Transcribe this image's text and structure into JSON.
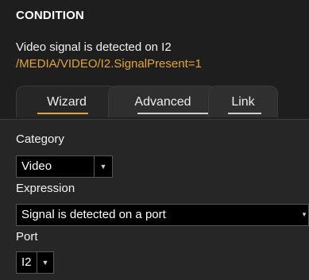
{
  "condition": {
    "heading": "CONDITION",
    "description": "Video signal is detected on I2",
    "path": "/MEDIA/VIDEO/I2.SignalPresent=1"
  },
  "tabs": [
    {
      "label": "Wizard",
      "active": true
    },
    {
      "label": "Advanced",
      "active": false
    },
    {
      "label": "Link",
      "active": false
    }
  ],
  "form": {
    "category_label": "Category",
    "category_value": "Video",
    "expression_label": "Expression",
    "expression_value": "Signal is detected on a port",
    "port_label": "Port",
    "port_value": "I2"
  },
  "icons": {
    "dropdown": "chevron-down-icon"
  },
  "colors": {
    "accent": "#e3a43b",
    "background": "#1b1b1b",
    "panel": "#262626",
    "field": "#000000"
  }
}
